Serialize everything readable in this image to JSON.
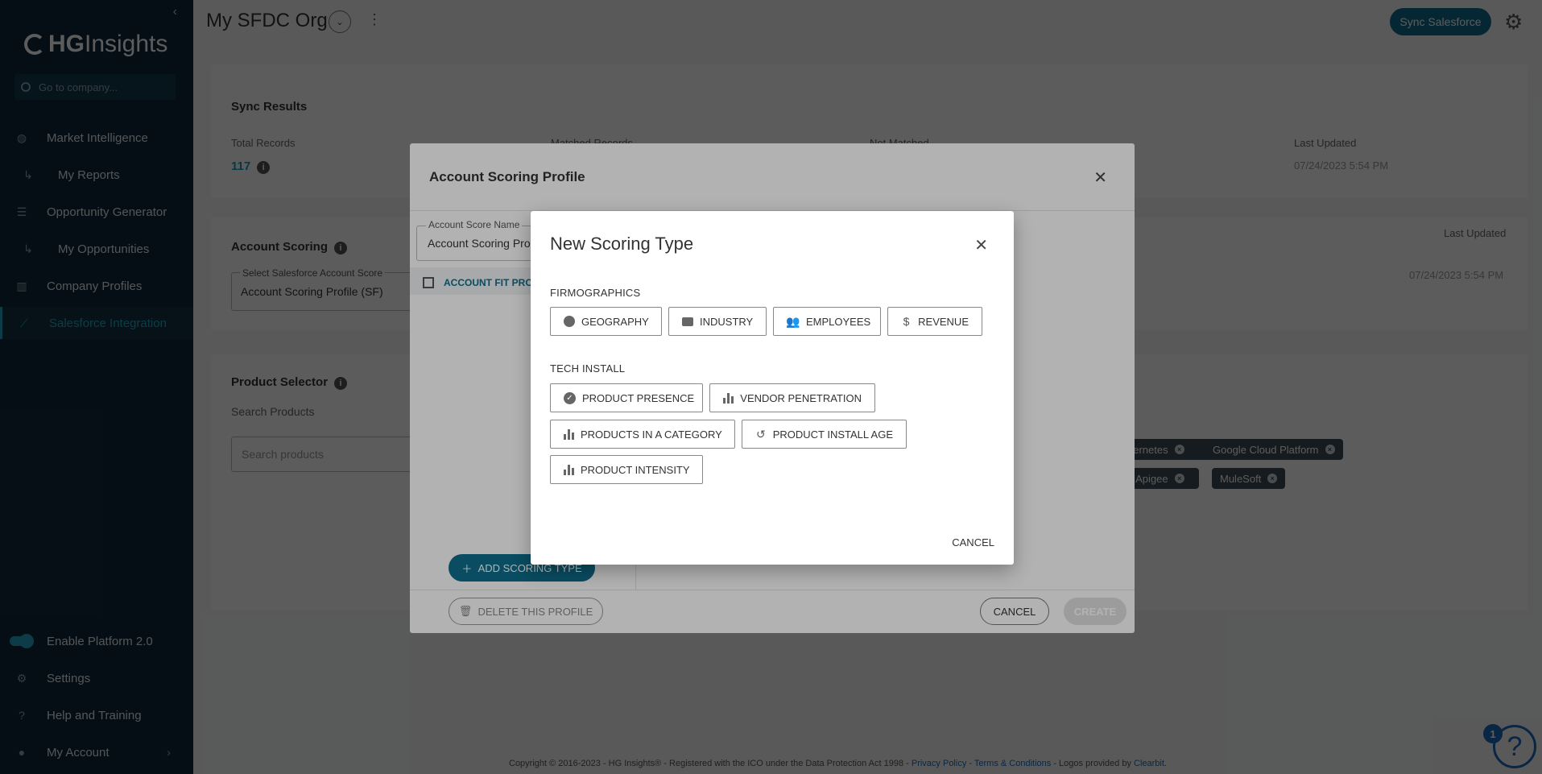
{
  "sidebar": {
    "collapse_glyph": "‹",
    "logo": {
      "bold": "HG",
      "light": "Insights"
    },
    "search_placeholder": "Go to company...",
    "items": [
      {
        "label": "Market Intelligence",
        "icon": "globe-icon"
      },
      {
        "label": "My Reports",
        "icon": "sub-arrow-icon"
      },
      {
        "label": "Opportunity Generator",
        "icon": "list-icon"
      },
      {
        "label": "My Opportunities",
        "icon": "sub-arrow-icon"
      },
      {
        "label": "Company Profiles",
        "icon": "building-icon"
      },
      {
        "label": "Salesforce Integration",
        "icon": "trend-icon",
        "active": true
      }
    ],
    "bottom": [
      {
        "label": "Enable Platform 2.0",
        "icon": "toggle-icon"
      },
      {
        "label": "Settings",
        "icon": "gear-icon"
      },
      {
        "label": "Help and Training",
        "icon": "help-icon"
      },
      {
        "label": "My Account",
        "icon": "user-icon"
      }
    ]
  },
  "topbar": {
    "org_title": "My SFDC Org",
    "sync_button": "Sync Salesforce"
  },
  "sync_results": {
    "title": "Sync Results",
    "total_label": "Total Records",
    "total_value": "117",
    "matched_label": "Matched Records",
    "not_matched_label": "Not Matched",
    "last_updated_label": "Last Updated",
    "last_updated_value": "07/24/2023 5:54 PM"
  },
  "account_scoring": {
    "title": "Account Scoring",
    "select_label": "Select Salesforce Account Score",
    "select_value": "Account Scoring Profile (SF)",
    "last_updated_label": "Last Updated",
    "last_updated_value": "07/24/2023 5:54 PM"
  },
  "product_selector": {
    "title": "Product Selector",
    "search_label": "Search Products",
    "search_placeholder": "Search products",
    "chips": [
      "bernetes",
      "Google Cloud Platform",
      "d Apigee",
      "MuleSoft"
    ]
  },
  "profile_dialog": {
    "title": "Account Scoring Profile",
    "name_label": "Account Score Name",
    "name_value": "Account Scoring Pro",
    "fit_label": "ACCOUNT FIT PRO",
    "add_button": "ADD SCORING TYPE",
    "delete_button": "DELETE THIS PROFILE",
    "cancel_button": "CANCEL",
    "create_button": "CREATE"
  },
  "scoring_dialog": {
    "title": "New Scoring Type",
    "firmographics_label": "FIRMOGRAPHICS",
    "firmographics": [
      {
        "label": "GEOGRAPHY",
        "icon": "globe-icon"
      },
      {
        "label": "INDUSTRY",
        "icon": "briefcase-icon"
      },
      {
        "label": "EMPLOYEES",
        "icon": "people-icon"
      },
      {
        "label": "REVENUE",
        "icon": "dollar-icon"
      }
    ],
    "tech_install_label": "TECH INSTALL",
    "tech_install": [
      {
        "label": "PRODUCT PRESENCE",
        "icon": "check-circle-icon"
      },
      {
        "label": "VENDOR PENETRATION",
        "icon": "bar-chart-icon"
      },
      {
        "label": "PRODUCTS IN A CATEGORY",
        "icon": "bar-chart-icon"
      },
      {
        "label": "PRODUCT INSTALL AGE",
        "icon": "history-icon"
      },
      {
        "label": "PRODUCT INTENSITY",
        "icon": "bar-chart-icon"
      }
    ],
    "cancel_button": "CANCEL"
  },
  "footer": {
    "text": "Copyright © 2016-2023 - HG Insights® - Registered with the ICO under the Data Protection Act 1998 - ",
    "privacy": "Privacy Policy",
    "sep1": " - ",
    "terms": "Terms & Conditions",
    "logos_text": " - Logos provided by ",
    "clearbit": "Clearbit",
    "end": "."
  },
  "help_badge": "1"
}
